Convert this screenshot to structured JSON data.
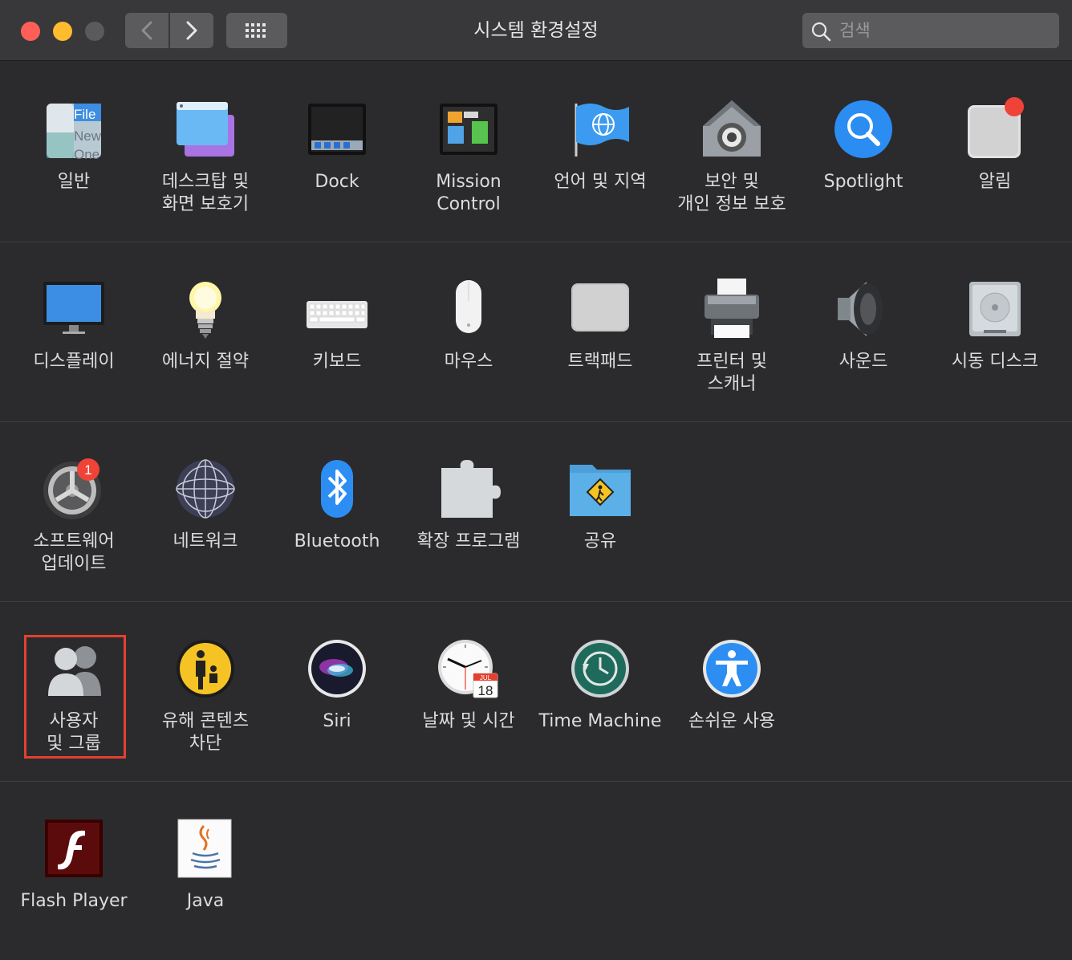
{
  "window": {
    "title": "시스템 환경설정",
    "search_placeholder": "검색"
  },
  "accent": "#e5402e",
  "rows": [
    [
      {
        "id": "general",
        "icon": "general-icon",
        "label": "일반"
      },
      {
        "id": "desktop",
        "icon": "desktop-screensaver-icon",
        "label": "데스크탑 및\n화면 보호기"
      },
      {
        "id": "dock",
        "icon": "dock-icon",
        "label": "Dock"
      },
      {
        "id": "mission",
        "icon": "mission-control-icon",
        "label": "Mission\nControl"
      },
      {
        "id": "language",
        "icon": "language-region-icon",
        "label": "언어 및 지역"
      },
      {
        "id": "security",
        "icon": "security-privacy-icon",
        "label": "보안 및\n개인 정보 보호"
      },
      {
        "id": "spotlight",
        "icon": "spotlight-icon",
        "label": "Spotlight"
      },
      {
        "id": "notifications",
        "icon": "notifications-icon",
        "label": "알림"
      }
    ],
    [
      {
        "id": "displays",
        "icon": "display-icon",
        "label": "디스플레이"
      },
      {
        "id": "energy",
        "icon": "energy-saver-icon",
        "label": "에너지 절약"
      },
      {
        "id": "keyboard",
        "icon": "keyboard-icon",
        "label": "키보드"
      },
      {
        "id": "mouse",
        "icon": "mouse-icon",
        "label": "마우스"
      },
      {
        "id": "trackpad",
        "icon": "trackpad-icon",
        "label": "트랙패드"
      },
      {
        "id": "printers",
        "icon": "printer-icon",
        "label": "프린터 및\n스캐너"
      },
      {
        "id": "sound",
        "icon": "sound-icon",
        "label": "사운드"
      },
      {
        "id": "startup",
        "icon": "startup-disk-icon",
        "label": "시동 디스크"
      }
    ],
    [
      {
        "id": "software",
        "icon": "software-update-icon",
        "label": "소프트웨어\n업데이트",
        "badge": "1"
      },
      {
        "id": "network",
        "icon": "network-icon",
        "label": "네트워크"
      },
      {
        "id": "bluetooth",
        "icon": "bluetooth-icon",
        "label": "Bluetooth"
      },
      {
        "id": "extensions",
        "icon": "extensions-icon",
        "label": "확장 프로그램"
      },
      {
        "id": "sharing",
        "icon": "sharing-icon",
        "label": "공유"
      }
    ],
    [
      {
        "id": "users",
        "icon": "users-groups-icon",
        "label": "사용자\n및 그룹",
        "highlighted": true
      },
      {
        "id": "parental",
        "icon": "parental-controls-icon",
        "label": "유해 콘텐츠\n차단"
      },
      {
        "id": "siri",
        "icon": "siri-icon",
        "label": "Siri"
      },
      {
        "id": "datetime",
        "icon": "date-time-icon",
        "label": "날짜 및 시간",
        "calendar_month": "JUL",
        "calendar_day": "18"
      },
      {
        "id": "timemachine",
        "icon": "time-machine-icon",
        "label": "Time Machine"
      },
      {
        "id": "accessibility",
        "icon": "accessibility-icon",
        "label": "손쉬운 사용"
      }
    ],
    [
      {
        "id": "flash",
        "icon": "flash-player-icon",
        "label": "Flash Player"
      },
      {
        "id": "java",
        "icon": "java-icon",
        "label": "Java"
      }
    ]
  ],
  "general_icon_text": [
    "File",
    "New",
    "One"
  ]
}
